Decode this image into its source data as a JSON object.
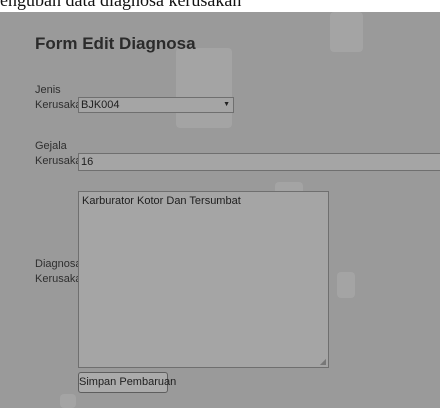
{
  "caption": "engubah data diagnosa kerusakan",
  "form": {
    "title": "Form Edit Diagnosa",
    "jenis": {
      "label_line1": "Jenis",
      "label_line2": "Kerusakan",
      "selected_value": "BJK004"
    },
    "gejala": {
      "label_line1": "Gejala",
      "label_line2": "Kerusakan",
      "value": "16"
    },
    "diagnosa": {
      "label_line1": "Diagnosa",
      "label_line2": "Kerusakan",
      "value": "Karburator Kotor Dan Tersumbat"
    },
    "submit_label": "Simpan Pembaruan"
  },
  "icons": {
    "dropdown": "chevron-down-icon",
    "resize": "resize-grip-icon"
  }
}
